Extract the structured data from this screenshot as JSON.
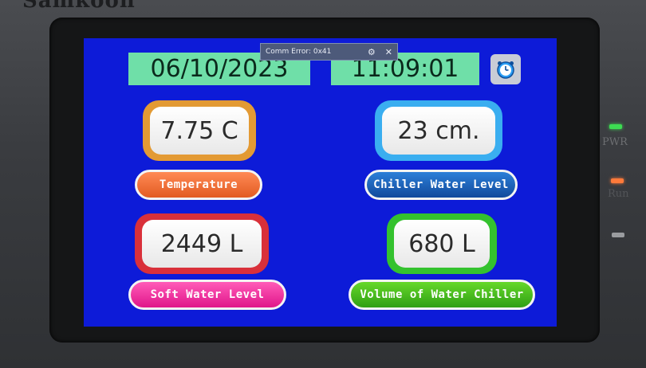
{
  "device": {
    "brand": "Samkoon"
  },
  "header": {
    "date": "06/10/2023",
    "time": "11:09:01"
  },
  "error_popup": {
    "title": "Comm Error: 0x41"
  },
  "readings": {
    "temperature": {
      "value": "7.75 C",
      "label": "Temperature"
    },
    "chiller_water_level": {
      "value": "23 cm.",
      "label": "Chiller Water Level"
    },
    "soft_water_level": {
      "value": "2449 L",
      "label": "Soft Water Level"
    },
    "volume_water_chiller": {
      "value": "680 L",
      "label": "Volume of Water Chiller"
    }
  },
  "indicators": {
    "pwr": {
      "label": "PWR",
      "color": "#3ddc52"
    },
    "run": {
      "label": "Run",
      "color": "#ff7a3a"
    },
    "com": {
      "color": "#9a9c9f"
    }
  },
  "colors": {
    "screen_bg": "#0d1bd8",
    "datetime_bg": "#6fdfa8"
  }
}
